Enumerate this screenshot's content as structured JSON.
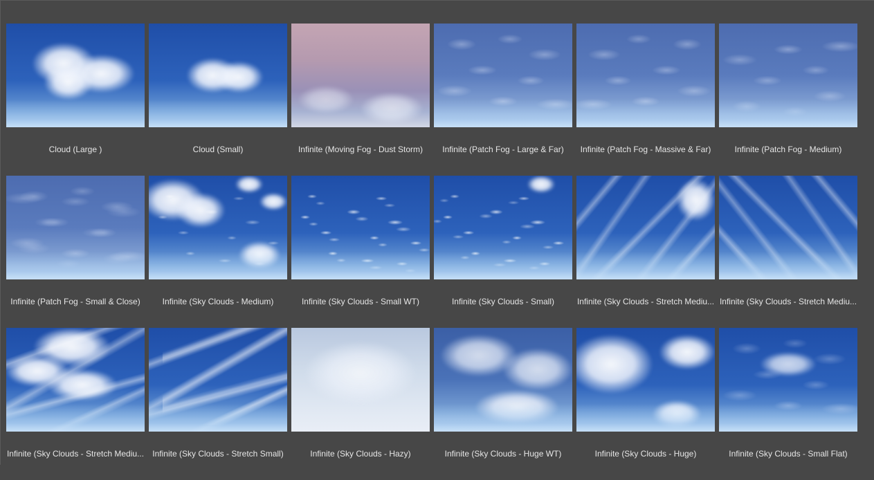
{
  "browser": {
    "items": [
      {
        "label": "Cloud (Large )",
        "icon": "sky-thumbnail"
      },
      {
        "label": "Cloud (Small)",
        "icon": "sky-thumbnail"
      },
      {
        "label": "Infinite (Moving Fog - Dust Storm)",
        "icon": "sky-thumbnail"
      },
      {
        "label": "Infinite (Patch Fog - Large & Far)",
        "icon": "sky-thumbnail"
      },
      {
        "label": "Infinite (Patch Fog - Massive & Far)",
        "icon": "sky-thumbnail"
      },
      {
        "label": "Infinite (Patch Fog - Medium)",
        "icon": "sky-thumbnail"
      },
      {
        "label": "Infinite (Patch Fog - Small & Close)",
        "icon": "sky-thumbnail"
      },
      {
        "label": "Infinite (Sky Clouds -  Medium)",
        "icon": "sky-thumbnail"
      },
      {
        "label": "Infinite (Sky Clouds -  Small WT)",
        "icon": "sky-thumbnail"
      },
      {
        "label": "Infinite (Sky Clouds -  Small)",
        "icon": "sky-thumbnail"
      },
      {
        "label": "Infinite (Sky Clouds -  Stretch Mediu...",
        "icon": "sky-thumbnail"
      },
      {
        "label": "Infinite (Sky Clouds -  Stretch Mediu...",
        "icon": "sky-thumbnail"
      },
      {
        "label": "Infinite (Sky Clouds -  Stretch Mediu...",
        "icon": "sky-thumbnail"
      },
      {
        "label": "Infinite (Sky Clouds -  Stretch Small)",
        "icon": "sky-thumbnail"
      },
      {
        "label": "Infinite (Sky Clouds - Hazy)",
        "icon": "sky-thumbnail"
      },
      {
        "label": "Infinite (Sky Clouds - Huge WT)",
        "icon": "sky-thumbnail"
      },
      {
        "label": "Infinite (Sky Clouds - Huge)",
        "icon": "sky-thumbnail"
      },
      {
        "label": "Infinite (Sky Clouds - Small Flat)",
        "icon": "sky-thumbnail"
      }
    ]
  },
  "colors": {
    "background": "#474747",
    "label_text": "#e6e6e6"
  }
}
